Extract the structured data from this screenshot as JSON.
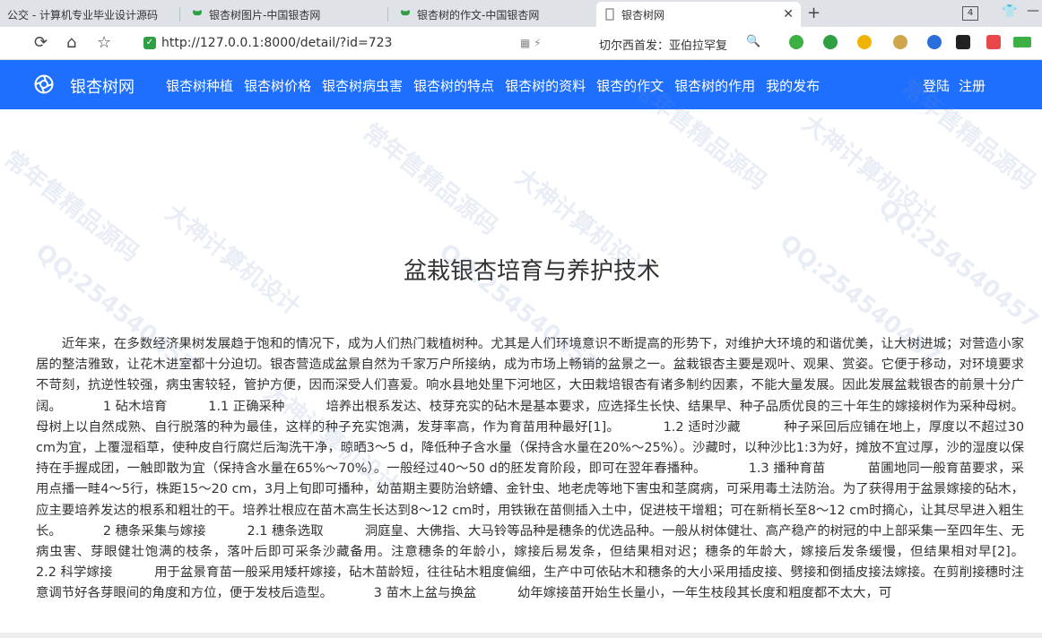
{
  "browser": {
    "tabs": [
      {
        "title": "公交 - 计算机专业毕业设计源码"
      },
      {
        "title": "银杏树图片-中国银杏网"
      },
      {
        "title": "银杏树的作文-中国银杏网"
      },
      {
        "title": "银杏树网"
      }
    ],
    "tab_count": "4",
    "url": "http://127.0.0.1:8000/detail/?id=723",
    "search_hint": "切尔西首发：亚伯拉罕复"
  },
  "site": {
    "brand": "银杏树网",
    "nav": [
      "银杏树种植",
      "银杏树价格",
      "银杏树病虫害",
      "银杏树的特点",
      "银杏树的资料",
      "银杏的作文",
      "银杏树的作用",
      "我的发布"
    ],
    "login": "登陆",
    "register": "注册",
    "header_color": "#1e6fff"
  },
  "article": {
    "title": "盆栽银杏培育与养护技术",
    "body": "近年来，在多数经济果树发展趋于饱和的情况下，成为人们热门栽植树种。尤其是人们环境意识不断提高的形势下，对维护大环境的和谐优美，让大树进城；对营造小家居的整洁雅致，让花木进室都十分迫切。银杏营造成盆景自然为千家万户所接纳，成为市场上畅销的盆景之一。盆栽银杏主要是观叶、观果、赏姿。它便于移动，对环境要求不苛刻，抗逆性较强，病虫害较轻，管护方便，因而深受人们喜爱。响水县地处里下河地区，大田栽培银杏有诸多制约因素，不能大量发展。因此发展盆栽银杏的前景十分广阔。          1 砧木培育          1.1 正确采种          培养出根系发达、枝芽充实的砧木是基本要求，应选择生长快、结果早、种子品质优良的三十年生的嫁接树作为采种母树。母树上以自然成熟、自行脱落的种为最佳，这样的种子充实饱满，发芽率高，作为育苗用种最好[1]。          1.2 适时沙藏          种子采回后应铺在地上，厚度以不超过30 cm为宜，上覆湿稻草，使种皮自行腐烂后淘洗干净，晾晒3～5 d，降低种子含水量（保持含水量在20%～25%）。沙藏时，以种沙比1:3为好，摊放不宜过厚，沙的湿度以保持在手握成团，一触即散为宜（保持含水量在65%～70%）。一般经过40～50 d的胚发育阶段，即可在翌年春播种。          1.3 播种育苗          苗圃地同一般育苗要求，采用点播一畦4～5行，株距15～20 cm，3月上旬即可播种，幼苗期主要防治蛴螬、金针虫、地老虎等地下害虫和茎腐病，可采用毒土法防治。为了获得用于盆景嫁接的砧木，应主要培养发达的根系和粗壮的干。培养壮根应在苗木高生长达到8～12 cm时，用铁锹在苗侧插入土中，促进枝干增粗；可在新梢长至8～12 cm时摘心，让其尽早进入粗生长。          2 穗条采集与嫁接          2.1 穗条选取          洞庭皇、大佛指、大马铃等品种是穗条的优选品种。一般从树体健壮、高产稳产的树冠的中上部采集一至四年生、无病虫害、芽眼健壮饱满的枝条，落叶后即可采条沙藏备用。注意穗条的年龄小，嫁接后易发条，但结果相对迟；穗条的年龄大，嫁接后发条缓慢，但结果相对早[2]。          2.2 科学嫁接          用于盆景育苗一般采用矮杆嫁接，砧木苗龄短，往往砧木粗度偏细，生产中可依砧木和穗条的大小采用插皮接、劈接和倒插皮接法嫁接。在剪削接穗时注意调节好各芽眼间的角度和方位，便于发枝后造型。          3 苗木上盆与换盆          幼年嫁接苗开始生长量小，一年生枝段其长度和粗度都不太大，可"
  },
  "watermarks": [
    "常年售精品源码",
    "QQ:254540457",
    "大神计算机设计",
    "常年售精品源码",
    "QQ:254540457",
    "大神计算机设计",
    "常年售精品源码",
    "QQ:254540457",
    "大神计算机设计",
    "QQ:254540457",
    "常年售精品源码",
    "大神计算机设计"
  ]
}
